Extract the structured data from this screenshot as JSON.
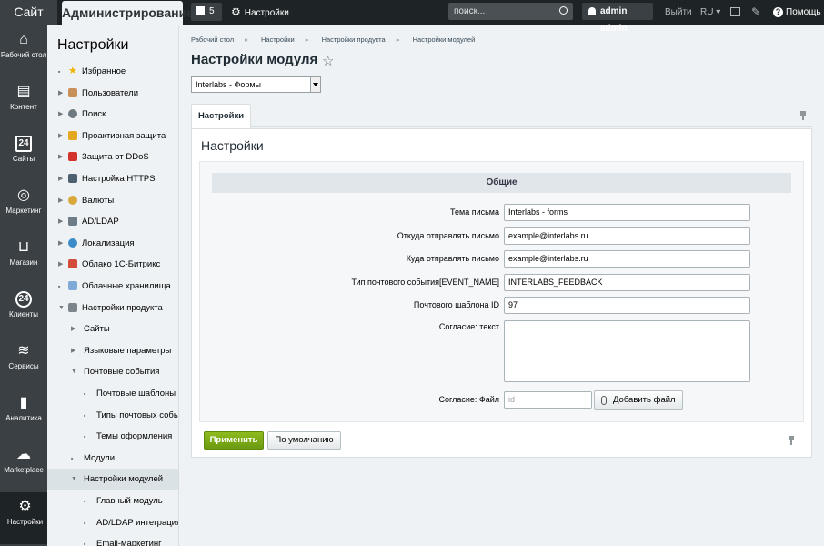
{
  "topbar": {
    "site_tab": "Сайт",
    "admin_tab": "Администрирование",
    "notifications_count": "5",
    "settings_label": "Настройки",
    "search_placeholder": "поиск...",
    "user_name": "admin admin",
    "logout": "Выйти",
    "lang": "RU",
    "help": "Помощь"
  },
  "leftnav": [
    {
      "label": "Рабочий стол",
      "icon": "home-icon"
    },
    {
      "label": "Контент",
      "icon": "document-icon"
    },
    {
      "label": "Сайты",
      "icon": "calendar-24-icon"
    },
    {
      "label": "Маркетинг",
      "icon": "target-icon"
    },
    {
      "label": "Магазин",
      "icon": "basket-icon"
    },
    {
      "label": "Клиенты",
      "icon": "clients-24-icon"
    },
    {
      "label": "Сервисы",
      "icon": "layers-icon"
    },
    {
      "label": "Аналитика",
      "icon": "bar-chart-icon"
    },
    {
      "label": "Marketplace",
      "icon": "cloud-download-icon"
    },
    {
      "label": "Настройки",
      "icon": "gear-icon"
    }
  ],
  "sidebar": {
    "title": "Настройки",
    "items": [
      {
        "label": "Избранное",
        "level": 0,
        "arrow": "bullet",
        "icon": "star-icon",
        "icon_color": "#f0b400"
      },
      {
        "label": "Пользователи",
        "level": 0,
        "arrow": "right",
        "icon": "user-icon",
        "icon_color": "#c9915a"
      },
      {
        "label": "Поиск",
        "level": 0,
        "arrow": "right",
        "icon": "search-icon",
        "icon_color": "#6f7a80"
      },
      {
        "label": "Проактивная защита",
        "level": 0,
        "arrow": "right",
        "icon": "lock-icon",
        "icon_color": "#e3a81c"
      },
      {
        "label": "Защита от DDoS",
        "level": 0,
        "arrow": "right",
        "icon": "shield-icon",
        "icon_color": "#d2342c"
      },
      {
        "label": "Настройка HTTPS",
        "level": 0,
        "arrow": "right",
        "icon": "https-icon",
        "icon_color": "#4d6070"
      },
      {
        "label": "Валюты",
        "level": 0,
        "arrow": "right",
        "icon": "coin-icon",
        "icon_color": "#d7a93a"
      },
      {
        "label": "AD/LDAP",
        "level": 0,
        "arrow": "right",
        "icon": "ldap-icon",
        "icon_color": "#6d7c86"
      },
      {
        "label": "Локализация",
        "level": 0,
        "arrow": "right",
        "icon": "globe-icon",
        "icon_color": "#3b8bc8"
      },
      {
        "label": "Облако 1С-Битрикс",
        "level": 0,
        "arrow": "right",
        "icon": "cloud-icon",
        "icon_color": "#d34b3a"
      },
      {
        "label": "Облачные хранилища",
        "level": 0,
        "arrow": "bullet",
        "icon": "storage-icon",
        "icon_color": "#7fa9d6"
      },
      {
        "label": "Настройки продукта",
        "level": 0,
        "arrow": "down",
        "icon": "gear-icon",
        "icon_color": "#7b858b"
      },
      {
        "label": "Сайты",
        "level": 1,
        "arrow": "right"
      },
      {
        "label": "Языковые параметры",
        "level": 1,
        "arrow": "right"
      },
      {
        "label": "Почтовые события",
        "level": 1,
        "arrow": "down"
      },
      {
        "label": "Почтовые шаблоны",
        "level": 2,
        "arrow": "bullet"
      },
      {
        "label": "Типы почтовых событий",
        "level": 2,
        "arrow": "bullet"
      },
      {
        "label": "Темы оформления",
        "level": 2,
        "arrow": "bullet"
      },
      {
        "label": "Модули",
        "level": 1,
        "arrow": "bullet"
      },
      {
        "label": "Настройки модулей",
        "level": 1,
        "arrow": "down",
        "active": true
      },
      {
        "label": "Главный модуль",
        "level": 2,
        "arrow": "bullet"
      },
      {
        "label": "AD/LDAP интеграция",
        "level": 2,
        "arrow": "bullet"
      },
      {
        "label": "Email-маркетинг",
        "level": 2,
        "arrow": "bullet"
      }
    ]
  },
  "breadcrumbs": [
    "Рабочий стол",
    "Настройки",
    "Настройки продукта",
    "Настройки модулей"
  ],
  "page_title": "Настройки модуля",
  "module_select": "Interlabs - Формы",
  "tab_label": "Настройки",
  "panel_title": "Настройки",
  "section_title": "Общие",
  "form": [
    {
      "label": "Тема письма",
      "value": "Interlabs - forms"
    },
    {
      "label": "Откуда отправлять письмо",
      "value": "example@interlabs.ru"
    },
    {
      "label": "Куда отправлять письмо",
      "value": "example@interlabs.ru"
    },
    {
      "label": "Тип почтового события[EVENT_NAME]",
      "value": "INTERLABS_FEEDBACK"
    },
    {
      "label": "Почтового шаблона ID",
      "value": "97"
    }
  ],
  "consent_text_label": "Согласие: текст",
  "consent_file_label": "Согласие: Файл",
  "consent_file_placeholder": "id",
  "add_file_button": "Добавить файл",
  "apply_button": "Применить",
  "default_button": "По умолчанию"
}
